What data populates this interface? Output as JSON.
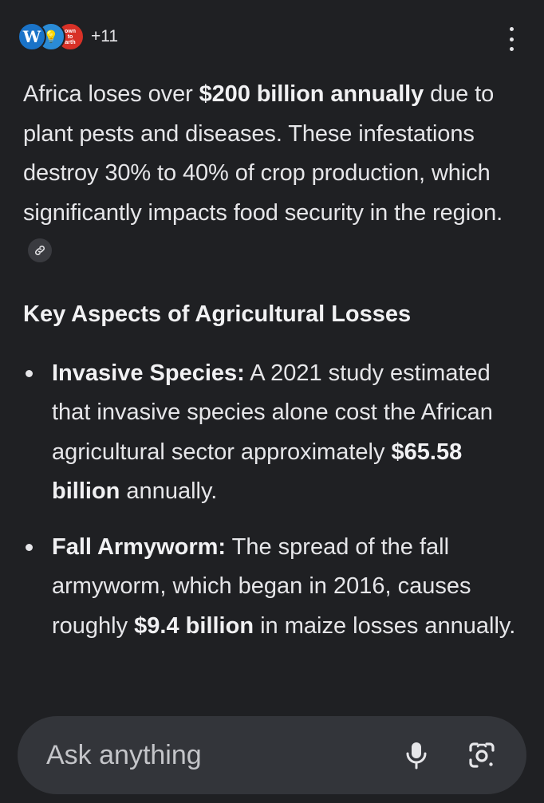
{
  "sources": {
    "icons": [
      "wordpress-icon",
      "lightbulb-icon",
      "down-to-earth-icon"
    ],
    "wp_glyph": "W",
    "bulb_glyph": "💡",
    "dte_lines": [
      "own",
      "to",
      "arth"
    ],
    "more_count": "+11"
  },
  "answer": {
    "intro": {
      "t1": "Africa loses over ",
      "b1": "$200 billion annually",
      "t2": " due to plant pests and diseases. These infestations destroy 30% to 40% of crop production, which significantly impacts food security in the region."
    },
    "heading": "Key Aspects of Agricultural Losses",
    "points": [
      {
        "label": "Invasive Species:",
        "t1": " A 2021 study estimated that invasive species alone cost the African agricultural sector approximately ",
        "b1": "$65.58 billion",
        "t2": " annually."
      },
      {
        "label": "Fall Armyworm:",
        "t1": " The spread of the fall armyworm, which began in 2016, causes roughly ",
        "b1": "$9.4 billion",
        "t2": " in maize losses annually."
      }
    ]
  },
  "composer": {
    "placeholder": "Ask anything"
  },
  "colors": {
    "background": "#1f2023",
    "text": "#e6e6e9",
    "composer": "#33353a"
  }
}
